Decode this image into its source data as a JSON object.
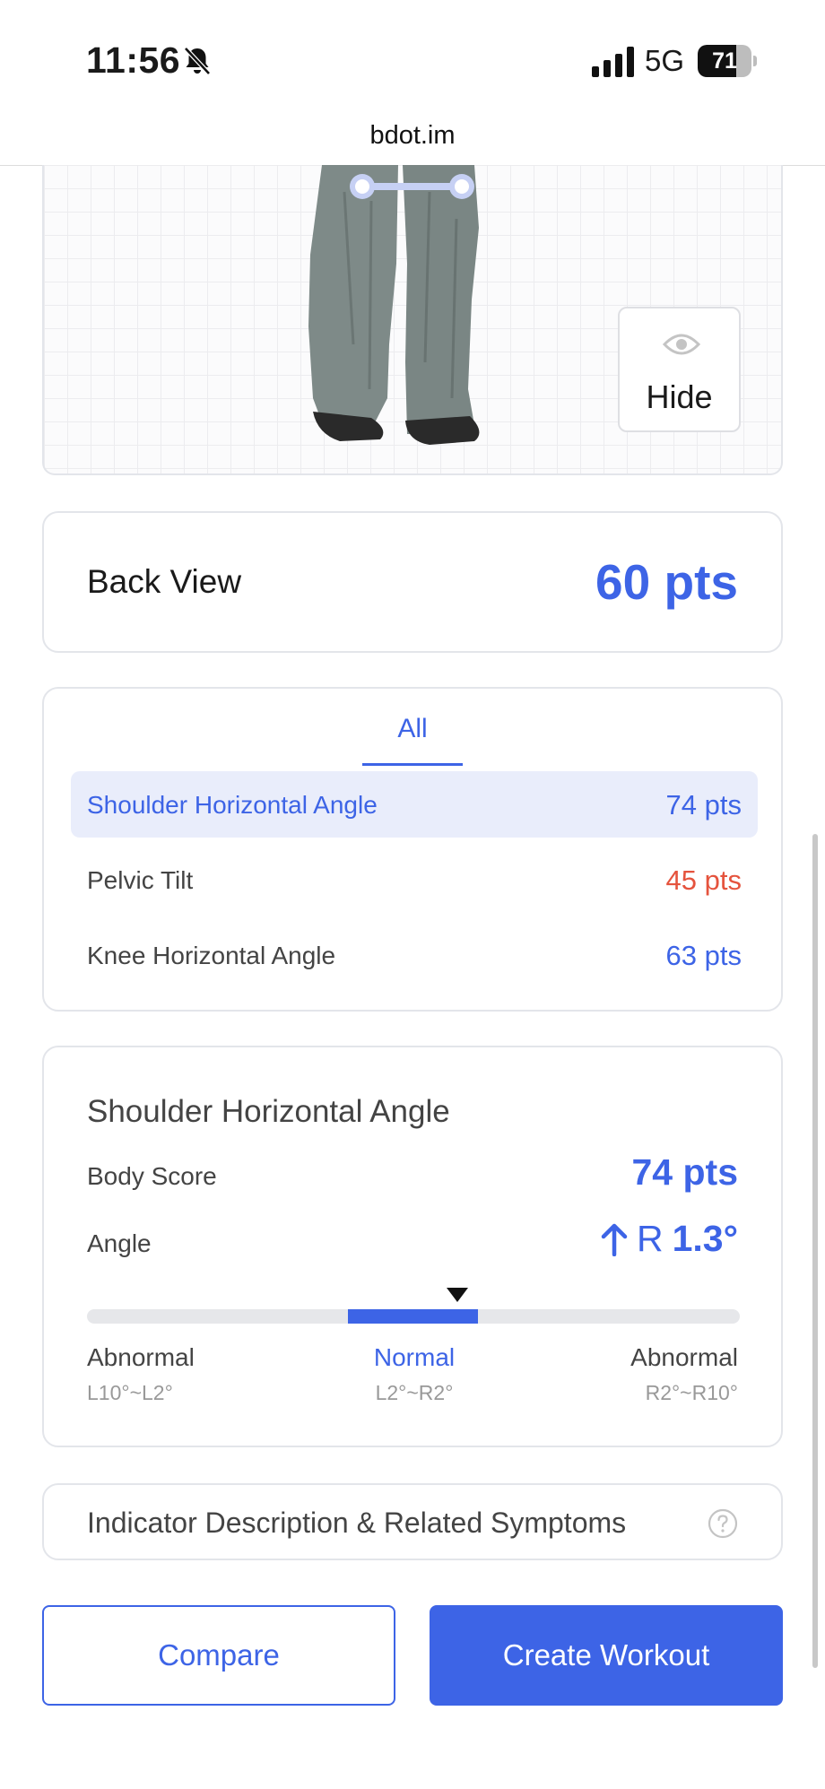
{
  "status_bar": {
    "time": "11:56",
    "network": "5G",
    "battery_percent": "71",
    "battery_level": 0.71,
    "icons": [
      "bell-slash-icon",
      "signal-bars-icon",
      "battery-icon"
    ]
  },
  "browser": {
    "url": "bdot.im"
  },
  "photo": {
    "hide_label": "Hide",
    "icon": "eye-icon"
  },
  "view": {
    "title": "Back View",
    "score": "60 pts"
  },
  "metrics": {
    "tab_all": "All",
    "items": [
      {
        "name": "Shoulder Horizontal Angle",
        "pts": "74 pts",
        "color": "#3d64e6",
        "selected": true
      },
      {
        "name": "Pelvic Tilt",
        "pts": "45 pts",
        "color": "#e5533d",
        "selected": false
      },
      {
        "name": "Knee Horizontal Angle",
        "pts": "63 pts",
        "color": "#3d64e6",
        "selected": false
      }
    ]
  },
  "detail": {
    "title": "Shoulder Horizontal Angle",
    "body_score_label": "Body Score",
    "body_score_value": "74 pts",
    "angle_label": "Angle",
    "angle_side": "R",
    "angle_value": "1.3°",
    "ranges": [
      {
        "name": "Abnormal",
        "range": "L10°~L2°"
      },
      {
        "name": "Normal",
        "range": "L2°~R2°"
      },
      {
        "name": "Abnormal",
        "range": "R2°~R10°"
      }
    ]
  },
  "indicator": {
    "label": "Indicator Description & Related Symptoms",
    "icon": "help-circle-icon"
  },
  "actions": {
    "compare": "Compare",
    "create_workout": "Create Workout"
  },
  "colors": {
    "accent": "#3d64e6",
    "warning": "#e5533d",
    "selected_bg": "#e9edfb"
  }
}
